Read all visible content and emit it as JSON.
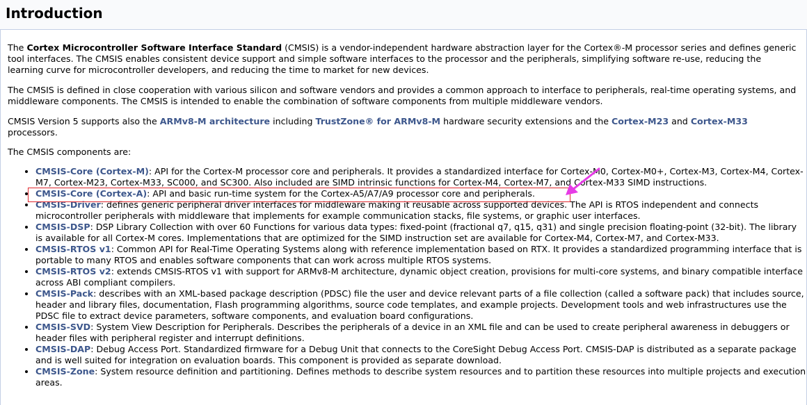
{
  "header": {
    "title": "Introduction"
  },
  "intro": {
    "p1_pre": "The ",
    "p1_bold": "Cortex Microcontroller Software Interface Standard",
    "p1_post": " (CMSIS) is a vendor-independent hardware abstraction layer for the Cortex®-M processor series and defines generic tool interfaces. The CMSIS enables consistent device support and simple software interfaces to the processor and the peripherals, simplifying software re-use, reducing the learning curve for microcontroller developers, and reducing the time to market for new devices.",
    "p2": "The CMSIS is defined in close cooperation with various silicon and software vendors and provides a common approach to interface to peripherals, real-time operating systems, and middleware components. The CMSIS is intended to enable the combination of software components from multiple middleware vendors.",
    "p3_a": "CMSIS Version 5 supports also the ",
    "p3_link1": "ARMv8-M architecture",
    "p3_b": " including ",
    "p3_link2": "TrustZone® for ARMv8-M",
    "p3_c": " hardware security extensions and the ",
    "p3_link3": "Cortex-M23",
    "p3_d": " and ",
    "p3_link4": "Cortex-M33",
    "p3_e": " processors.",
    "p4": "The CMSIS components are:"
  },
  "components": [
    {
      "link": "CMSIS-Core (Cortex-M)",
      "text": ": API for the Cortex-M processor core and peripherals. It provides a standardized interface for Cortex-M0, Cortex-M0+, Cortex-M3, Cortex-M4, Cortex-M7, Cortex-M23, Cortex-M33, SC000, and SC300. Also included are SIMD intrinsic functions for Cortex-M4, Cortex-M7, and Cortex-M33 SIMD instructions."
    },
    {
      "link": "CMSIS-Core (Cortex-A)",
      "text": ": API and basic run-time system for the Cortex-A5/A7/A9 processor core and peripherals."
    },
    {
      "link": "CMSIS-Driver",
      "text": ": defines generic peripheral driver interfaces for middleware making it reusable across supported devices. The API is RTOS independent and connects microcontroller peripherals with middleware that implements for example communication stacks, file systems, or graphic user interfaces."
    },
    {
      "link": "CMSIS-DSP",
      "text": ": DSP Library Collection with over 60 Functions for various data types: fixed-point (fractional q7, q15, q31) and single precision floating-point (32-bit). The library is available for all Cortex-M cores. Implementations that are optimized for the SIMD instruction set are available for Cortex-M4, Cortex-M7, and Cortex-M33."
    },
    {
      "link": "CMSIS-RTOS v1",
      "text": ": Common API for Real-Time Operating Systems along with reference implementation based on RTX. It provides a standardized programming interface that is portable to many RTOS and enables software components that can work across multiple RTOS systems."
    },
    {
      "link": "CMSIS-RTOS v2",
      "text": ": extends CMSIS-RTOS v1 with support for ARMv8-M architecture, dynamic object creation, provisions for multi-core systems, and binary compatible interface across ABI compliant compilers."
    },
    {
      "link": "CMSIS-Pack",
      "text": ": describes with an XML-based package description (PDSC) file the user and device relevant parts of a file collection (called a software pack) that includes source, header and library files, documentation, Flash programming algorithms, source code templates, and example projects. Development tools and web infrastructures use the PDSC file to extract device parameters, software components, and evaluation board configurations."
    },
    {
      "link": "CMSIS-SVD",
      "text": ": System View Description for Peripherals. Describes the peripherals of a device in an XML file and can be used to create peripheral awareness in debuggers or header files with peripheral register and interrupt definitions."
    },
    {
      "link": "CMSIS-DAP",
      "text": ": Debug Access Port. Standardized firmware for a Debug Unit that connects to the CoreSight Debug Access Port. CMSIS-DAP is distributed as a separate package and is well suited for integration on evaluation boards. This component is provided as separate download."
    },
    {
      "link": "CMSIS-Zone",
      "text": ": System resource definition and partitioning. Defines methods to describe system resources and to partition these resources into multiple projects and execution areas."
    }
  ],
  "colors": {
    "link": "#3d578c",
    "highlight_box": "#e0282e",
    "arrow": "#e63ce6",
    "header_border": "#c4cfe5"
  }
}
